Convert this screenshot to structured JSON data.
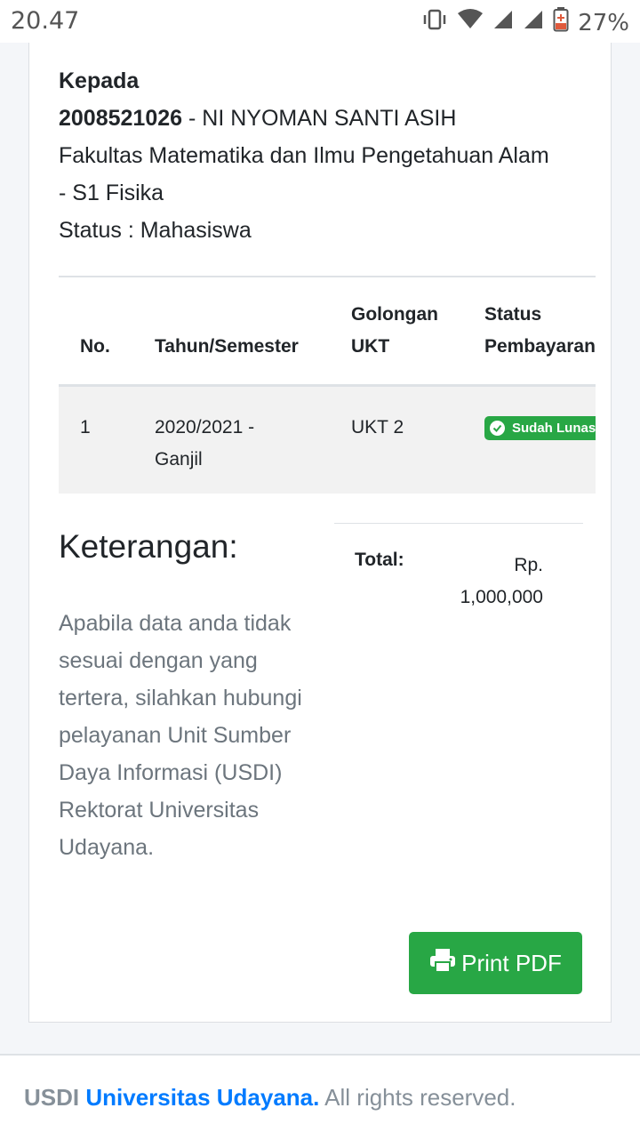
{
  "status_bar": {
    "time": "20.47",
    "battery": "27%",
    "icons": [
      "vibrate-icon",
      "wifi-icon",
      "signal-icon",
      "signal-icon",
      "battery-icon"
    ]
  },
  "recipient": {
    "heading": "Kepada",
    "nim": "2008521026",
    "name_suffix": " - NI NYOMAN SANTI ASIH",
    "faculty_line1": "Fakultas Matematika dan Ilmu Pengetahuan Alam",
    "faculty_line2": "- S1 Fisika",
    "status": "Status : Mahasiswa"
  },
  "table": {
    "headers": [
      "No.",
      "Tahun/Semester",
      "Golongan",
      "UKT",
      "Status",
      "Pembayaran"
    ],
    "rows": [
      {
        "no": "1",
        "year": "2020/2021 -",
        "semester": "Ganjil",
        "golongan": "UKT 2",
        "status": "Sudah Lunas"
      }
    ]
  },
  "notes": {
    "title": "Keterangan:",
    "text": "Apabila data anda tidak sesuai dengan yang tertera, silahkan hubungi pelayanan Unit Sumber Daya Informasi (USDI) Rektorat Universitas Udayana."
  },
  "total": {
    "label": "Total:",
    "currency": "Rp.",
    "amount": "1,000,000"
  },
  "actions": {
    "print_label": "Print PDF"
  },
  "footer": {
    "org": "USDI",
    "link": "Universitas Udayana.",
    "rights": " All rights reserved."
  },
  "colors": {
    "accent_green": "#28a745",
    "link_blue": "#007bff"
  }
}
